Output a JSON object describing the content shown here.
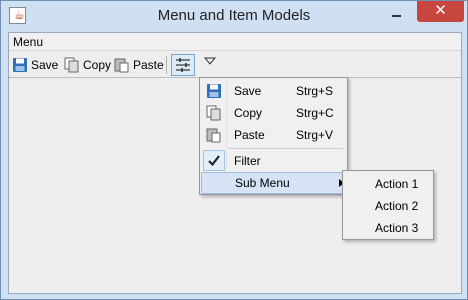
{
  "window": {
    "title": "Menu and Item Models"
  },
  "menubar": {
    "items": [
      "Menu"
    ]
  },
  "toolbar": {
    "save_label": "Save",
    "copy_label": "Copy",
    "paste_label": "Paste",
    "filter_icon": "filter-icon",
    "overflow_icon": "chevron-down-icon"
  },
  "popup_menu": {
    "items": [
      {
        "label": "Save",
        "shortcut": "Strg+S",
        "icon": "save-icon"
      },
      {
        "label": "Copy",
        "shortcut": "Strg+C",
        "icon": "copy-icon"
      },
      {
        "label": "Paste",
        "shortcut": "Strg+V",
        "icon": "paste-icon"
      },
      {
        "label": "Filter",
        "checked": true
      },
      {
        "label": "Sub Menu",
        "has_submenu": true
      }
    ]
  },
  "submenu": {
    "items": [
      "Action 1",
      "Action 2",
      "Action 3"
    ]
  },
  "colors": {
    "titlebar": "#cfe0f3",
    "close_button": "#c7463d",
    "highlight": "#d5e3f4"
  }
}
